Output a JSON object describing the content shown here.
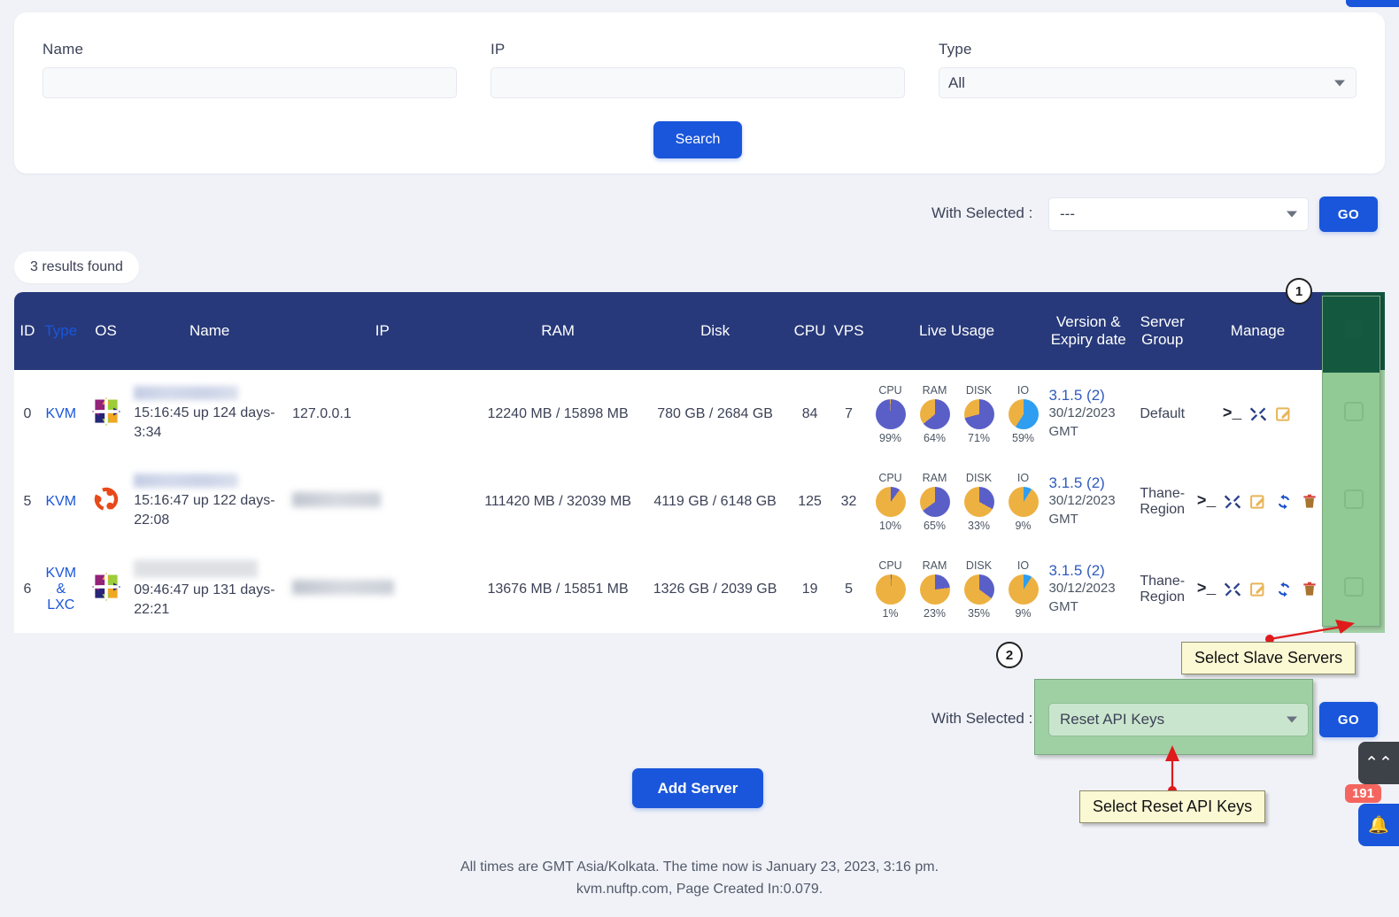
{
  "search": {
    "name_label": "Name",
    "name_value": "",
    "name_placeholder": "",
    "ip_label": "IP",
    "ip_value": "",
    "ip_placeholder": "",
    "type_label": "Type",
    "type_value": "All",
    "search_button": "Search"
  },
  "top_action_bar": {
    "with_selected_label": "With Selected :",
    "selected_value": "---",
    "go_label": "GO"
  },
  "results": {
    "count_text": "3 results found"
  },
  "table": {
    "columns": [
      "ID",
      "Type",
      "OS",
      "Name",
      "IP",
      "RAM",
      "Disk",
      "CPU",
      "VPS",
      "Live Usage",
      "Version & Expiry date",
      "Server Group",
      "Manage",
      ""
    ],
    "rows": [
      {
        "id": "0",
        "type": "KVM",
        "os_icon": "centos-icon",
        "name_masked": true,
        "uptime": "15:16:45 up 124 days- 3:34",
        "ip": "127.0.0.1",
        "ip_masked": false,
        "ram": "12240 MB / 15898 MB",
        "disk": "780 GB / 2684 GB",
        "cpu": "84",
        "vps": "7",
        "usage": [
          {
            "label": "CPU",
            "value": 99,
            "text": "99%",
            "fg": "#5a5fc7",
            "bg": "#edb141"
          },
          {
            "label": "RAM",
            "value": 64,
            "text": "64%",
            "fg": "#5a5fc7",
            "bg": "#edb141"
          },
          {
            "label": "DISK",
            "value": 71,
            "text": "71%",
            "fg": "#5a5fc7",
            "bg": "#edb141"
          },
          {
            "label": "IO",
            "value": 59,
            "text": "59%",
            "fg": "#2f9ef0",
            "bg": "#edb141"
          }
        ],
        "version": "3.1.5 (2)",
        "expiry": "30/12/2023 GMT",
        "group": "Default",
        "manage": [
          "terminal-icon",
          "tools-icon",
          "edit-icon"
        ],
        "checked": false
      },
      {
        "id": "5",
        "type": "KVM",
        "os_icon": "ubuntu-icon",
        "name_masked": true,
        "uptime": "15:16:47 up 122 days- 22:08",
        "ip": "",
        "ip_masked": true,
        "ram": "111420 MB / 32039 MB",
        "disk": "4119 GB / 6148 GB",
        "cpu": "125",
        "vps": "32",
        "usage": [
          {
            "label": "CPU",
            "value": 10,
            "text": "10%",
            "fg": "#5a5fc7",
            "bg": "#edb141"
          },
          {
            "label": "RAM",
            "value": 65,
            "text": "65%",
            "fg": "#5a5fc7",
            "bg": "#edb141"
          },
          {
            "label": "DISK",
            "value": 33,
            "text": "33%",
            "fg": "#5a5fc7",
            "bg": "#edb141"
          },
          {
            "label": "IO",
            "value": 9,
            "text": "9%",
            "fg": "#2f9ef0",
            "bg": "#edb141"
          }
        ],
        "version": "3.1.5 (2)",
        "expiry": "30/12/2023 GMT",
        "group": "Thane-Region",
        "manage": [
          "terminal-icon",
          "tools-icon",
          "edit-icon",
          "refresh-icon",
          "delete-icon"
        ],
        "checked": false
      },
      {
        "id": "6",
        "type": "KVM & LXC",
        "os_icon": "centos-icon",
        "name_masked": true,
        "uptime": "09:46:47 up 131 days- 22:21",
        "ip": "",
        "ip_masked": true,
        "ram": "13676 MB / 15851 MB",
        "disk": "1326 GB / 2039 GB",
        "cpu": "19",
        "vps": "5",
        "usage": [
          {
            "label": "CPU",
            "value": 1,
            "text": "1%",
            "fg": "#5a5fc7",
            "bg": "#edb141"
          },
          {
            "label": "RAM",
            "value": 23,
            "text": "23%",
            "fg": "#5a5fc7",
            "bg": "#edb141"
          },
          {
            "label": "DISK",
            "value": 35,
            "text": "35%",
            "fg": "#5a5fc7",
            "bg": "#edb141"
          },
          {
            "label": "IO",
            "value": 9,
            "text": "9%",
            "fg": "#2f9ef0",
            "bg": "#edb141"
          }
        ],
        "version": "3.1.5 (2)",
        "expiry": "30/12/2023 GMT",
        "group": "Thane-Region",
        "manage": [
          "terminal-icon",
          "tools-icon",
          "edit-icon",
          "refresh-icon",
          "delete-icon"
        ],
        "checked": false
      }
    ]
  },
  "bottom_action_bar": {
    "with_selected_label": "With Selected :",
    "selected_value": "Reset API Keys",
    "go_label": "GO"
  },
  "add_server_button": "Add Server",
  "annotations": {
    "step1": "1",
    "step2": "2",
    "callout1": "Select Slave Servers",
    "callout2": "Select Reset API Keys",
    "arrow_color": "#e01b1b"
  },
  "footer": {
    "line1": "All times are GMT Asia/Kolkata. The time now is January 23, 2023, 3:16 pm.",
    "line2": "kvm.nuftp.com, Page Created In:0.079."
  },
  "widgets": {
    "scroll_top_icon": "chevron-double-up-icon",
    "notification_icon": "bell-icon",
    "notification_count": "191"
  },
  "colors": {
    "accent": "#1a56db",
    "header": "#27397a",
    "highlight_green": "#8cc891",
    "dark_green": "#0c5039",
    "callout_bg": "#fbf8d4"
  }
}
